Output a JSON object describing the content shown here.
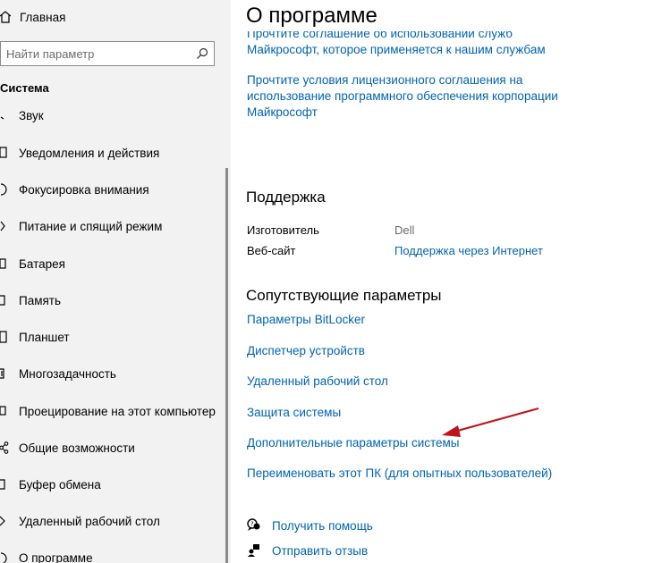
{
  "sidebar": {
    "home_label": "Главная",
    "search_placeholder": "Найти параметр",
    "section_title": "Система",
    "items": [
      {
        "label": "Звук",
        "icon": "sound-icon"
      },
      {
        "label": "Уведомления и действия",
        "icon": "notifications-icon"
      },
      {
        "label": "Фокусировка внимания",
        "icon": "focus-assist-icon"
      },
      {
        "label": "Питание и спящий режим",
        "icon": "power-icon"
      },
      {
        "label": "Батарея",
        "icon": "battery-icon"
      },
      {
        "label": "Память",
        "icon": "storage-icon"
      },
      {
        "label": "Планшет",
        "icon": "tablet-icon"
      },
      {
        "label": "Многозадачность",
        "icon": "multitasking-icon"
      },
      {
        "label": "Проецирование на этот компьютер",
        "icon": "projecting-icon"
      },
      {
        "label": "Общие возможности",
        "icon": "shared-experiences-icon"
      },
      {
        "label": "Буфер обмена",
        "icon": "clipboard-icon"
      },
      {
        "label": "Удаленный рабочий стол",
        "icon": "remote-desktop-icon"
      },
      {
        "label": "О программе",
        "icon": "info-icon"
      }
    ]
  },
  "main": {
    "title": "О программе",
    "top_links": [
      {
        "text": "Прочтите соглашение об использовании служб Майкрософт, которое применяется к нашим службам"
      },
      {
        "text": "Прочтите условия лицензионного соглашения на использование программного обеспечения корпорации Майкрософт"
      }
    ],
    "support": {
      "heading": "Поддержка",
      "manufacturer_label": "Изготовитель",
      "manufacturer_value": "Dell",
      "website_label": "Веб-сайт",
      "website_value": "Поддержка через Интернет"
    },
    "related": {
      "heading": "Сопутствующие параметры",
      "links": [
        "Параметры BitLocker",
        "Диспетчер устройств",
        "Удаленный рабочий стол",
        "Защита системы",
        "Дополнительные параметры системы",
        "Переименовать этот ПК (для опытных пользователей)"
      ]
    },
    "help": {
      "get_help": "Получить помощь",
      "feedback": "Отправить отзыв"
    }
  },
  "colors": {
    "link": "#0063b1",
    "sidebar_bg": "#f2f2f2",
    "annotation_arrow": "#c0141b"
  }
}
